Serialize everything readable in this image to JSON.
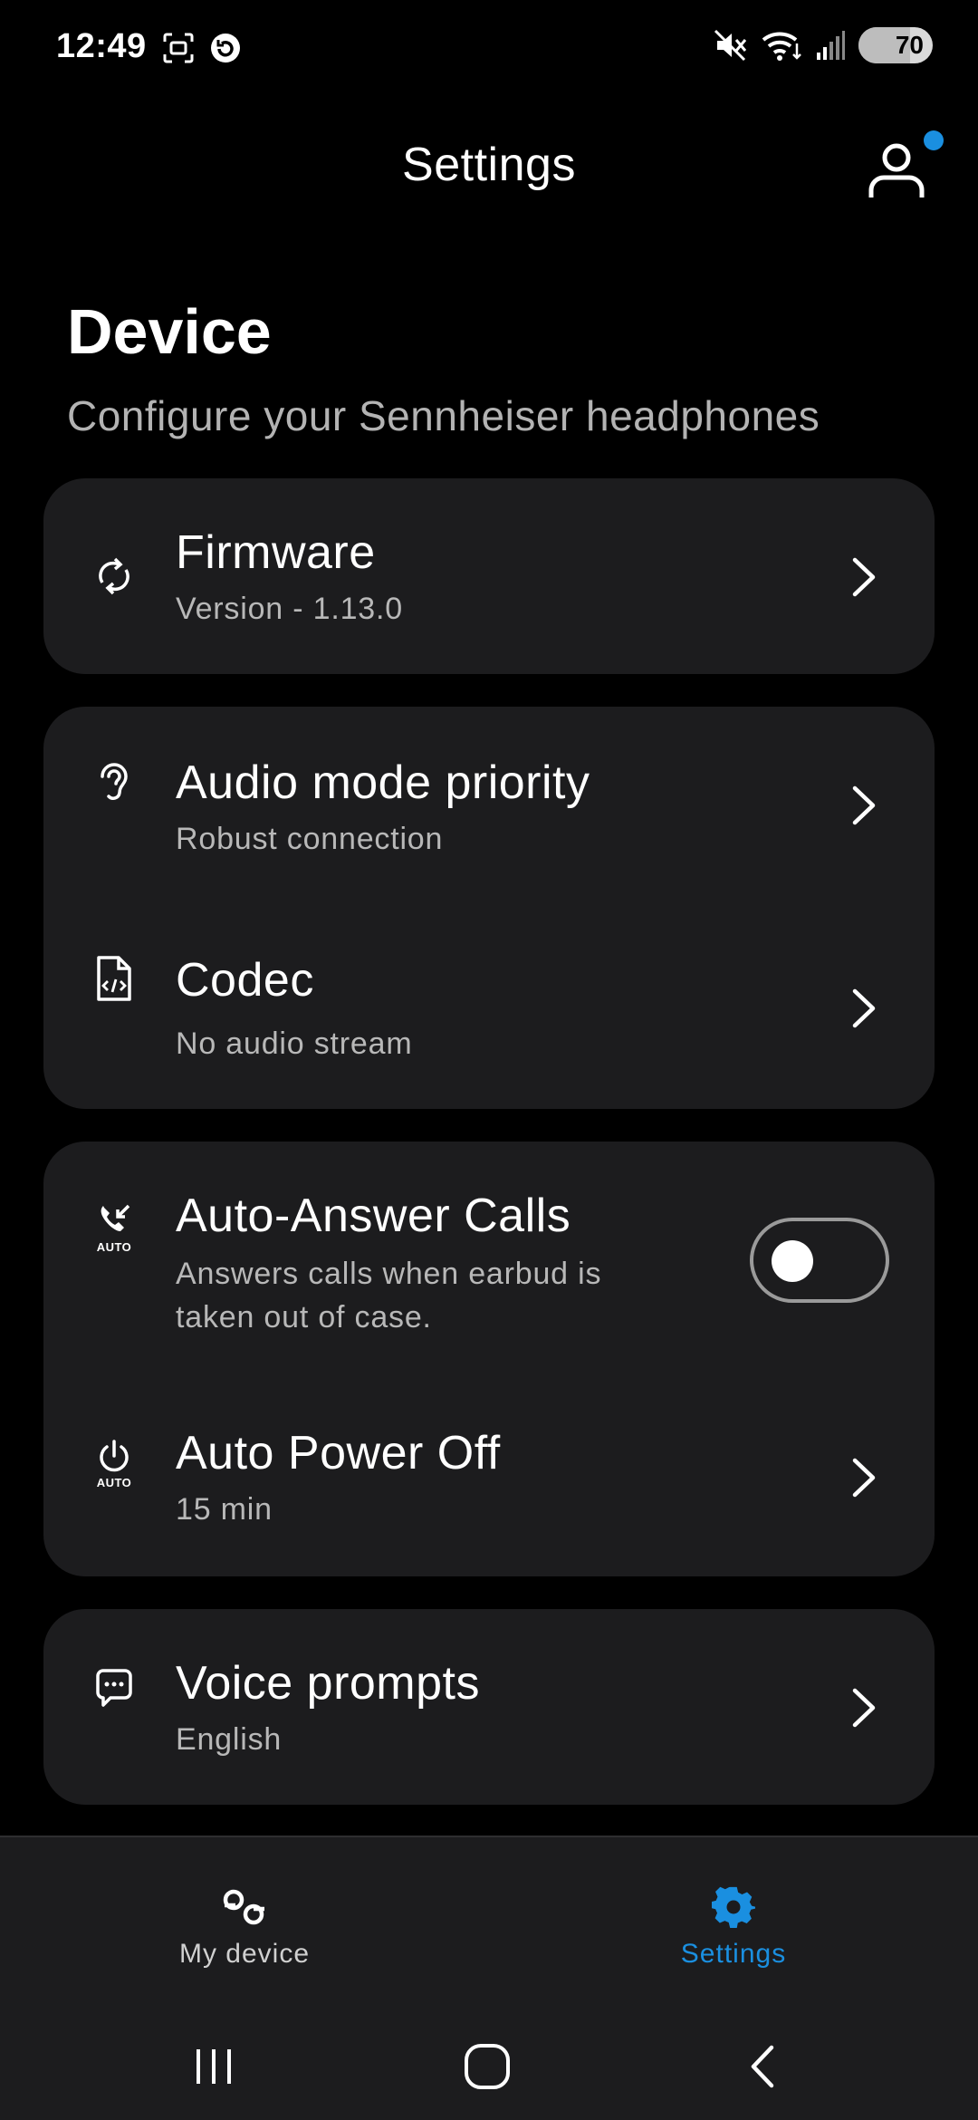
{
  "status_bar": {
    "time": "12:49",
    "battery_level": "70",
    "battery_fraction": 0.7
  },
  "header": {
    "title": "Settings",
    "profile_icon": "person-icon",
    "notification_dot_color": "#1a8fe0"
  },
  "section": {
    "title": "Device",
    "subtitle": "Configure your Sennheiser headphones"
  },
  "cards": {
    "firmware": {
      "icon": "sync-icon",
      "title": "Firmware",
      "subtitle": "Version - 1.13.0"
    },
    "audio_mode": {
      "icon": "ear-icon",
      "title": "Audio mode priority",
      "subtitle": "Robust connection"
    },
    "codec": {
      "icon": "code-file-icon",
      "title": "Codec",
      "subtitle": "No audio stream"
    },
    "auto_answer": {
      "icon": "auto-answer-call-icon",
      "icon_label": "AUTO",
      "title": "Auto-Answer Calls",
      "subtitle_line1": "Answers calls when earbud is",
      "subtitle_line2": "taken out of case.",
      "toggle_on": false
    },
    "auto_power": {
      "icon": "power-icon",
      "icon_label": "AUTO",
      "title": "Auto Power Off",
      "subtitle": "15 min"
    },
    "voice_prompts": {
      "icon": "chat-bubble-icon",
      "title": "Voice prompts",
      "subtitle": "English"
    }
  },
  "bottom_nav": {
    "items": [
      {
        "label": "My device",
        "icon": "earbuds-icon",
        "active": false
      },
      {
        "label": "Settings",
        "icon": "gear-icon",
        "active": true
      }
    ],
    "active_color": "#1a8fe0"
  }
}
